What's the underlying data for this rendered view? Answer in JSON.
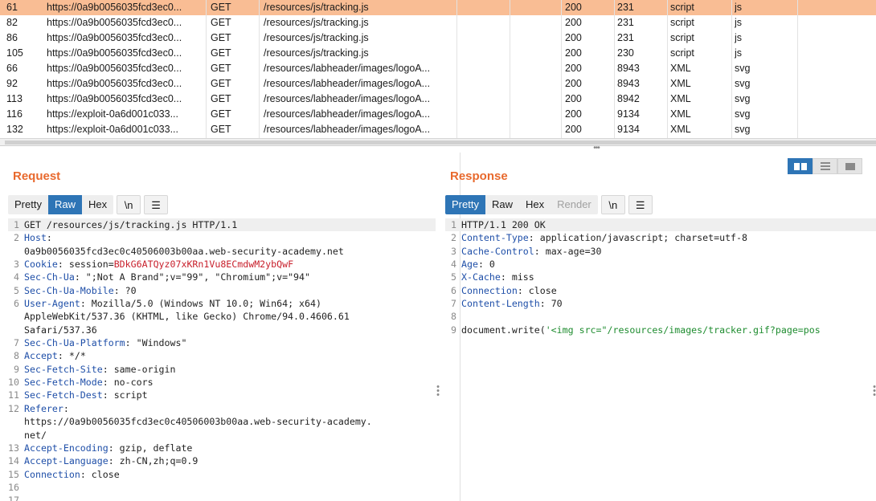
{
  "table": {
    "rows": [
      {
        "num": "61",
        "host": "https://0a9b0056035fcd3ec0...",
        "method": "GET",
        "url": "/resources/js/tracking.js",
        "status": "200",
        "length": "231",
        "mime": "script",
        "ext": "js",
        "selected": true
      },
      {
        "num": "82",
        "host": "https://0a9b0056035fcd3ec0...",
        "method": "GET",
        "url": "/resources/js/tracking.js",
        "status": "200",
        "length": "231",
        "mime": "script",
        "ext": "js"
      },
      {
        "num": "86",
        "host": "https://0a9b0056035fcd3ec0...",
        "method": "GET",
        "url": "/resources/js/tracking.js",
        "status": "200",
        "length": "231",
        "mime": "script",
        "ext": "js"
      },
      {
        "num": "105",
        "host": "https://0a9b0056035fcd3ec0...",
        "method": "GET",
        "url": "/resources/js/tracking.js",
        "status": "200",
        "length": "230",
        "mime": "script",
        "ext": "js"
      },
      {
        "num": "66",
        "host": "https://0a9b0056035fcd3ec0...",
        "method": "GET",
        "url": "/resources/labheader/images/logoA...",
        "status": "200",
        "length": "8943",
        "mime": "XML",
        "ext": "svg"
      },
      {
        "num": "92",
        "host": "https://0a9b0056035fcd3ec0...",
        "method": "GET",
        "url": "/resources/labheader/images/logoA...",
        "status": "200",
        "length": "8943",
        "mime": "XML",
        "ext": "svg"
      },
      {
        "num": "113",
        "host": "https://0a9b0056035fcd3ec0...",
        "method": "GET",
        "url": "/resources/labheader/images/logoA...",
        "status": "200",
        "length": "8942",
        "mime": "XML",
        "ext": "svg"
      },
      {
        "num": "116",
        "host": "https://exploit-0a6d001c033...",
        "method": "GET",
        "url": "/resources/labheader/images/logoA...",
        "status": "200",
        "length": "9134",
        "mime": "XML",
        "ext": "svg"
      },
      {
        "num": "132",
        "host": "https://exploit-0a6d001c033...",
        "method": "GET",
        "url": "/resources/labheader/images/logoA...",
        "status": "200",
        "length": "9134",
        "mime": "XML",
        "ext": "svg"
      }
    ]
  },
  "request": {
    "title": "Request",
    "tabs": [
      "Pretty",
      "Raw",
      "Hex"
    ],
    "active_tab": "Raw",
    "newline_toggle": "\\n",
    "menu_icon": "hamburger-icon",
    "lines": [
      {
        "num": "1",
        "text": "GET /resources/js/tracking.js HTTP/1.1"
      },
      {
        "num": "2",
        "name": "Host",
        "value": "\n0a9b0056035fcd3ec0c40506003b00aa.web-security-academy.net"
      },
      {
        "num": "3",
        "name": "Cookie",
        "value": "session=",
        "highlight": "BDkG6ATQyz07xKRn1Vu8ECmdwM2ybQwF"
      },
      {
        "num": "4",
        "name": "Sec-Ch-Ua",
        "value": "\";Not A Brand\";v=\"99\", \"Chromium\";v=\"94\""
      },
      {
        "num": "5",
        "name": "Sec-Ch-Ua-Mobile",
        "value": "?0"
      },
      {
        "num": "6",
        "name": "User-Agent",
        "value": "Mozilla/5.0 (Windows NT 10.0; Win64; x64)\nAppleWebKit/537.36 (KHTML, like Gecko) Chrome/94.0.4606.61\nSafari/537.36"
      },
      {
        "num": "7",
        "name": "Sec-Ch-Ua-Platform",
        "value": "\"Windows\""
      },
      {
        "num": "8",
        "name": "Accept",
        "value": "*/*"
      },
      {
        "num": "9",
        "name": "Sec-Fetch-Site",
        "value": "same-origin"
      },
      {
        "num": "10",
        "name": "Sec-Fetch-Mode",
        "value": "no-cors"
      },
      {
        "num": "11",
        "name": "Sec-Fetch-Dest",
        "value": "script"
      },
      {
        "num": "12",
        "name": "Referer",
        "value": "\nhttps://0a9b0056035fcd3ec0c40506003b00aa.web-security-academy.\nnet/"
      },
      {
        "num": "13",
        "name": "Accept-Encoding",
        "value": "gzip, deflate"
      },
      {
        "num": "14",
        "name": "Accept-Language",
        "value": "zh-CN,zh;q=0.9"
      },
      {
        "num": "15",
        "name": "Connection",
        "value": "close"
      },
      {
        "num": "16",
        "text": ""
      },
      {
        "num": "17",
        "text": ""
      }
    ]
  },
  "response": {
    "title": "Response",
    "tabs": [
      "Pretty",
      "Raw",
      "Hex",
      "Render"
    ],
    "active_tab": "Pretty",
    "disabled_tab": "Render",
    "newline_toggle": "\\n",
    "menu_icon": "hamburger-icon",
    "lines": [
      {
        "num": "1",
        "text": "HTTP/1.1 200 OK"
      },
      {
        "num": "2",
        "name": "Content-Type",
        "value": "application/javascript; charset=utf-8"
      },
      {
        "num": "3",
        "name": "Cache-Control",
        "value": "max-age=30"
      },
      {
        "num": "4",
        "name": "Age",
        "value": "0"
      },
      {
        "num": "5",
        "name": "X-Cache",
        "value": "miss"
      },
      {
        "num": "6",
        "name": "Connection",
        "value": "close"
      },
      {
        "num": "7",
        "name": "Content-Length",
        "value": "70"
      },
      {
        "num": "8",
        "text": ""
      },
      {
        "num": "9",
        "text": "document.write(",
        "str": "'<img src=\"/resources/images/tracker.gif?page=pos"
      }
    ]
  },
  "layout_buttons": [
    "side-by-side-icon",
    "stacked-icon",
    "single-pane-icon"
  ],
  "colors": {
    "selected_row": "#f9bd94",
    "accent": "#e8692d",
    "active_tab": "#2e75b6",
    "header_name": "#1f4fa8",
    "cookie_value": "#c8202c",
    "string": "#1e8c2f"
  }
}
